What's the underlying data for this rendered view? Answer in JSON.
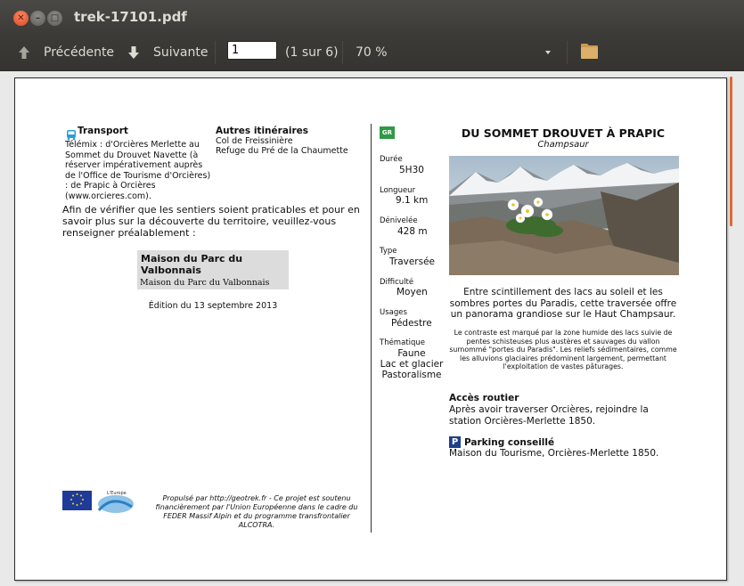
{
  "window": {
    "title": "trek-17101.pdf"
  },
  "toolbar": {
    "prev_label": "Précédente",
    "next_label": "Suivante",
    "page_value": "1",
    "page_count": "(1 sur 6)",
    "zoom": "70 %"
  },
  "left": {
    "transport_title": "Transport",
    "transport_text": "Télémix : d'Orcières Merlette au Sommet du Drouvet Navette (à réserver impérativement auprès de l'Office de Tourisme d'Orcières) : de Prapic à Orcières (www.orcieres.com).",
    "autres_title": "Autres itinéraires",
    "autres_1": "Col de Freissinière",
    "autres_2": "Refuge du Pré de la Chaumette",
    "verify_text": "Afin de vérifier que les sentiers soient praticables et pour en savoir plus sur la découverte du territoire, veuillez-vous renseigner préalablement :",
    "maison_title": "Maison du Parc du Valbonnais",
    "maison_sub": "Maison du Parc du Valbonnais",
    "edition": "Édition du 13 septembre 2013",
    "footer_text": "Propulsé par http://geotrek.fr - Ce projet est soutenu financièrement par l'Union Européenne dans le cadre du FEDER Massif Alpin et du programme transfrontalier ALCOTRA.",
    "logo2_top": "L'Europe"
  },
  "info": {
    "badge": "GR",
    "duree_label": "Durée",
    "duree": "5H30",
    "longueur_label": "Longueur",
    "longueur": "9.1 km",
    "denivelee_label": "Dénivelée",
    "denivelee": "428 m",
    "type_label": "Type",
    "type": "Traversée",
    "difficulte_label": "Difficulté",
    "difficulte": "Moyen",
    "usages_label": "Usages",
    "usages": "Pédestre",
    "thematique_label": "Thématique",
    "thematique": [
      "Faune",
      "Lac et glacier",
      "Pastoralisme"
    ]
  },
  "right": {
    "title": "DU SOMMET DROUVET À PRAPIC",
    "subtitle": "Champsaur",
    "intro": "Entre scintillement des lacs au soleil et les sombres portes du Paradis, cette traversée offre un panorama grandiose sur le Haut Champsaur.",
    "desc": "Le contraste est marqué par la zone humide des lacs suivie de pentes schisteuses plus austères et sauvages du vallon surnommé \"portes du Paradis\". Les reliefs sédimentaires, comme les alluvions glaciaires prédominent largement, permettant l'exploitation de vastes pâturages.",
    "acces_title": "Accès routier",
    "acces_text": "Après avoir traverser Orcières, rejoindre la station Orcières-Merlette 1850.",
    "parking_title": "Parking conseillé",
    "parking_text": "Maison du Tourisme, Orcières-Merlette 1850."
  },
  "colors": {
    "titlebar": "#3c3b37",
    "close": "#e1461b",
    "scroll": "#e06b33"
  }
}
